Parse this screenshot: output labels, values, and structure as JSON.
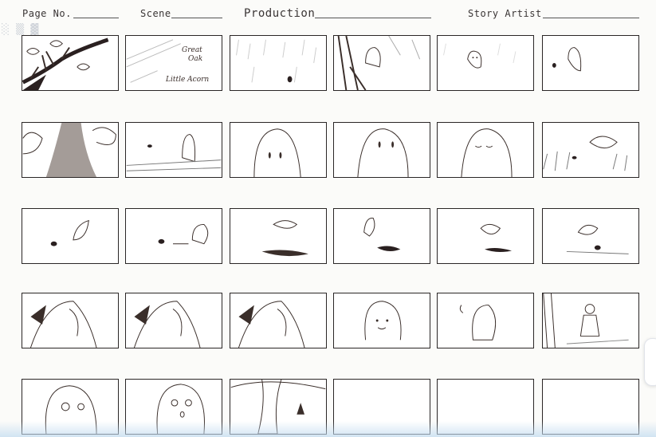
{
  "header": {
    "page_no_label": "Page No.",
    "scene_label": "Scene",
    "production_label": "Production",
    "story_artist_label": "Story Artist"
  },
  "panel_texts": {
    "great": "Great",
    "oak": "Oak",
    "little_acorn": "Little Acorn"
  },
  "sketch_color": "#3a2e2a"
}
